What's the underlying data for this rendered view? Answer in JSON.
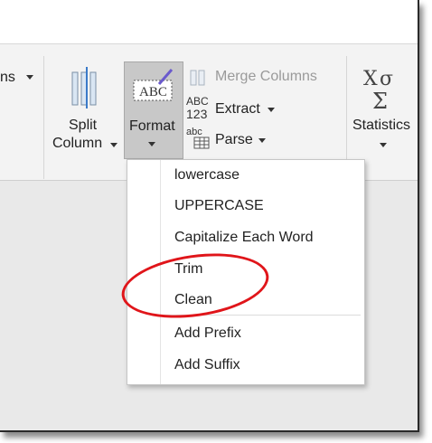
{
  "ribbon": {
    "partial_left_label": "ns",
    "split_column": {
      "line1": "Split",
      "line2": "Column"
    },
    "format": {
      "label": "Format",
      "icon_text": "ABC"
    },
    "merge_columns": "Merge Columns",
    "extract": {
      "label": "Extract",
      "icon_top": "ABC",
      "icon_bottom": "123"
    },
    "parse": {
      "label": "Parse",
      "icon_text": "abc"
    },
    "statistics": {
      "label": "Statistics",
      "icon_text": "XΣ"
    }
  },
  "format_menu": {
    "items": [
      "lowercase",
      "UPPERCASE",
      "Capitalize Each Word",
      "Trim",
      "Clean",
      "Add Prefix",
      "Add Suffix"
    ]
  },
  "colors": {
    "annotation": "#e0151a",
    "selected_button": "#c8c8c8"
  }
}
